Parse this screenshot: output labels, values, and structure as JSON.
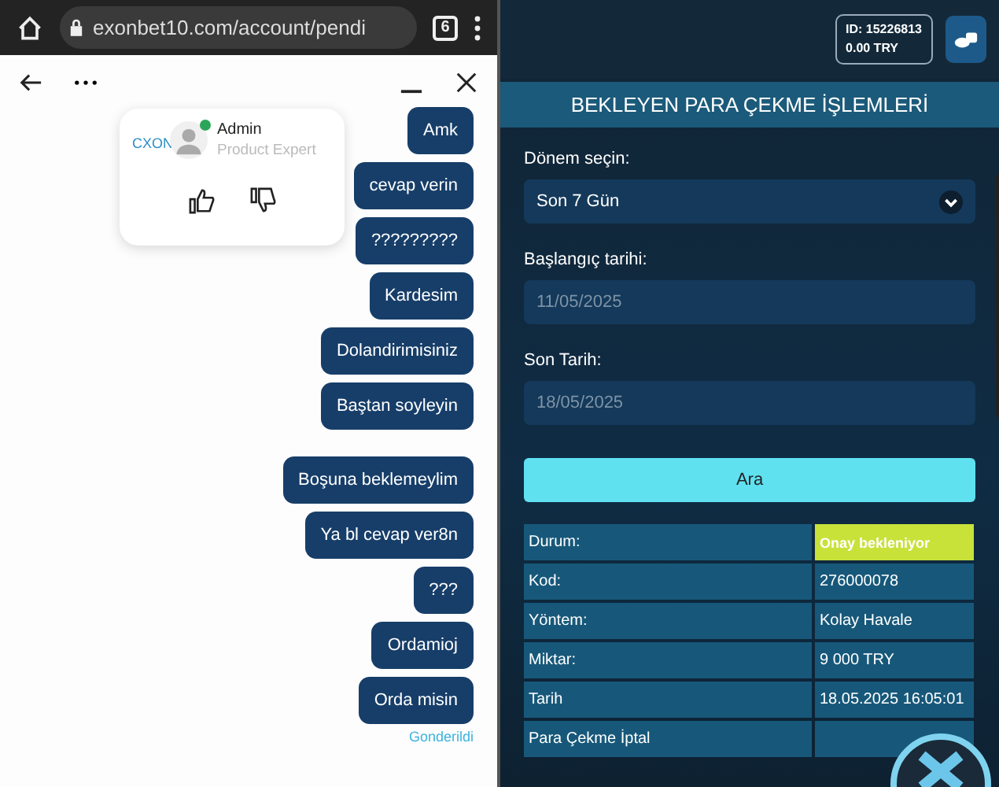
{
  "browser": {
    "url": "exonbet10.com/account/pendi",
    "tab_count": "6"
  },
  "chat": {
    "popup": {
      "logo": "CXON",
      "name": "Admin",
      "role": "Product Expert",
      "online": true
    },
    "message_groups": [
      [
        "Amk",
        "cevap verin",
        "?????????",
        "Kardesim",
        "Dolandirimisiniz",
        "Baştan soyleyin"
      ],
      [
        "Boşuna beklemeylim",
        "Ya bl cevap ver8n",
        "???",
        "Ordamioj",
        "Orda misin"
      ]
    ],
    "status": "Gonderildi"
  },
  "site": {
    "account": {
      "id": "ID: 15226813",
      "balance": "0.00 TRY"
    },
    "title": "BEKLEYEN PARA ÇEKME İŞLEMLERİ",
    "period": {
      "label": "Dönem seçin:",
      "value": "Son 7 Gün"
    },
    "start": {
      "label": "Başlangıç tarihi:",
      "value": "11/05/2025"
    },
    "end": {
      "label": "Son Tarih:",
      "value": "18/05/2025"
    },
    "search_button": "Ara",
    "rows": [
      {
        "label": "Durum:",
        "value": "Onay bekleniyor",
        "kind": "status"
      },
      {
        "label": "Kod:",
        "value": "276000078",
        "kind": "plain"
      },
      {
        "label": "Yöntem:",
        "value": "Kolay Havale",
        "kind": "plain"
      },
      {
        "label": "Miktar:",
        "value": "9 000 TRY",
        "kind": "plain"
      },
      {
        "label": "Tarih",
        "value": "18.05.2025 16:05:01",
        "kind": "plain"
      },
      {
        "label": "Para Çekme İptal",
        "value": "",
        "kind": "plain"
      }
    ]
  }
}
